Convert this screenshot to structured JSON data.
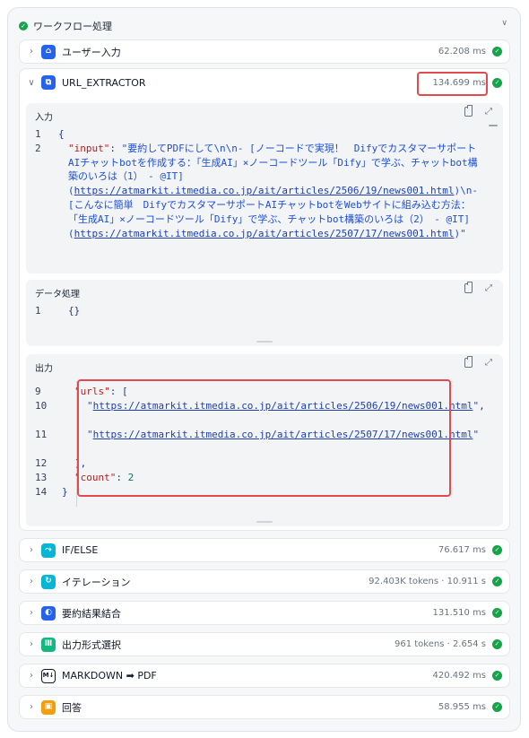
{
  "workflow": {
    "title": "ワークフロー処理"
  },
  "nodes": {
    "user_input": {
      "label": "ユーザー入力",
      "meta": "62.208 ms"
    },
    "url_extractor": {
      "label": "URL_EXTRACTOR",
      "meta": "134.699 ms"
    },
    "if_else": {
      "label": "IF/ELSE",
      "meta": "76.617 ms"
    },
    "iteration": {
      "label": "イテレーション",
      "meta": "92.403K tokens · 10.911 s"
    },
    "summary_merge": {
      "label": "要約結果結合",
      "meta": "131.510 ms"
    },
    "output_format": {
      "label": "出力形式選択",
      "meta": "961 tokens · 2.654 s"
    },
    "markdown_pdf": {
      "label": "MARKDOWN ➡ PDF",
      "meta": "420.492 ms"
    },
    "answer": {
      "label": "回答",
      "meta": "58.955 ms"
    }
  },
  "panels": {
    "input": {
      "title": "入力",
      "lines": [
        {
          "n": "1",
          "t": "{"
        },
        {
          "n": "2",
          "key": "\"input\"",
          "sep": ": ",
          "v1": "\"要約してPDFにして\\n\\n- [ノーコードで実現！　Difyでカスタマーサポート",
          "v2": "AIチャットbotを作成する：「生成AI」×ノーコードツール「Dify」で学ぶ、チャットbot構築のいろは（1）　- @IT](",
          "u1": "https://atmarkit.itmedia.co.jp/ait/articles/2506/19/news001.html",
          "v3": ")\\n- [こんなに簡単　Difyでカスタマーサポート",
          "v4": "AIチャットbotをWebサイトに組み込む方法：「生成AI」×ノーコードツール「Dify」で学ぶ、チャットbot構築のいろは（2）　- @IT](",
          "u2": "https://atmarkit.itmedia.co.jp/ait/articles/2507/17/news001.html",
          "v5": ")\""
        }
      ]
    },
    "data": {
      "title": "データ処理",
      "lines": [
        {
          "n": "1",
          "t": "{}"
        }
      ]
    },
    "output": {
      "title": "出力",
      "urls_key": "\"urls\"",
      "url1": "https://atmarkit.itmedia.co.jp/ait/articles/2506/19/news001.html",
      "url2": "https://atmarkit.itmedia.co.jp/ait/articles/2507/17/news001.html",
      "count_key": "\"count\"",
      "count_val": "2",
      "line_numbers": [
        "9",
        "10",
        "11",
        "12",
        "13",
        "14"
      ]
    }
  },
  "colors": {
    "success": "#16a34a",
    "highlight": "#e5484d"
  }
}
